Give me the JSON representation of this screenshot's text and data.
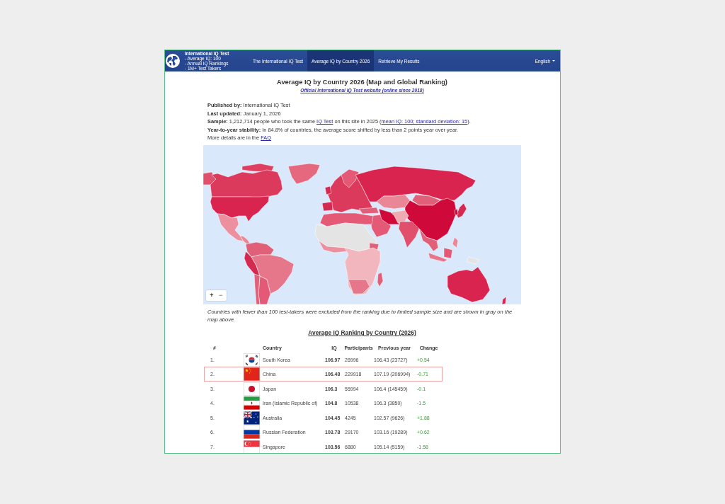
{
  "header": {
    "brand": {
      "name": "International IQ Test",
      "taglines": [
        "- Average IQ: 100",
        "- Annual IQ Rankings",
        "- 1M+ Test Takers"
      ]
    },
    "nav": [
      {
        "label": "The International IQ Test",
        "selected": false
      },
      {
        "label": "Average IQ by Country 2026",
        "selected": true
      },
      {
        "label": "Retrieve My Results",
        "selected": false
      }
    ],
    "language": "English"
  },
  "title": "Average IQ by Country 2026 (Map and Global Ranking)",
  "subtitle_link": "Official International IQ Test website (online since 2018)",
  "details": [
    {
      "segments": [
        {
          "kind": "bold",
          "text": "Published by:"
        },
        {
          "kind": "text",
          "text": " International IQ Test"
        }
      ]
    },
    {
      "segments": [
        {
          "kind": "bold",
          "text": "Last updated:"
        },
        {
          "kind": "text",
          "text": " January 1, 2026"
        }
      ]
    },
    {
      "segments": [
        {
          "kind": "bold",
          "text": "Sample:"
        },
        {
          "kind": "text",
          "text": " 1,212,714 people who took the same "
        },
        {
          "kind": "link",
          "text": "IQ Test"
        },
        {
          "kind": "text",
          "text": " on this site in 2025 ("
        },
        {
          "kind": "link",
          "text": "mean IQ: 100; standard deviation: 15"
        },
        {
          "kind": "text",
          "text": ")."
        }
      ]
    },
    {
      "segments": [
        {
          "kind": "bold",
          "text": "Year-to-year stability:"
        },
        {
          "kind": "text",
          "text": " In 84.8% of countries, the average score shifted by less than 2 points year over year."
        }
      ]
    },
    {
      "segments": [
        {
          "kind": "text",
          "text": "More details are in the "
        },
        {
          "kind": "link",
          "text": "FAQ"
        }
      ]
    }
  ],
  "map": {
    "zoom_buttons": [
      {
        "label": "+",
        "disabled": false
      },
      {
        "label": "−",
        "disabled": true
      }
    ]
  },
  "map_note": "Countries with fewer than 100 test-takers were excluded from the ranking due to limited sample size and are shown in gray on the map above.",
  "ranking": {
    "title": "Average IQ Ranking by Country (2026)",
    "columns": [
      "#",
      "Country",
      "IQ",
      "Participants",
      "Previous year",
      "Change"
    ],
    "rows": [
      {
        "rank": "1.",
        "country": "South Korea",
        "iq": "106.97",
        "participants": "26996",
        "previous_year": "106.43 (23727)",
        "change": "+0.54",
        "highlighted": false
      },
      {
        "rank": "2.",
        "country": "China",
        "iq": "106.48",
        "participants": "229918",
        "previous_year": "107.19 (206994)",
        "change": "-0.71",
        "highlighted": true
      },
      {
        "rank": "3.",
        "country": "Japan",
        "iq": "106.3",
        "participants": "55994",
        "previous_year": "106.4 (145459)",
        "change": "-0.1",
        "highlighted": false
      },
      {
        "rank": "4.",
        "country": "Iran (Islamic Republic of)",
        "iq": "104.8",
        "participants": "10538",
        "previous_year": "106.3 (3850)",
        "change": "-1.5",
        "highlighted": false
      },
      {
        "rank": "5.",
        "country": "Australia",
        "iq": "104.45",
        "participants": "4245",
        "previous_year": "102.57 (9626)",
        "change": "+1.88",
        "highlighted": false
      },
      {
        "rank": "6.",
        "country": "Russian Federation",
        "iq": "103.78",
        "participants": "29170",
        "previous_year": "103.16 (19289)",
        "change": "+0.62",
        "highlighted": false
      },
      {
        "rank": "7.",
        "country": "Singapore",
        "iq": "103.56",
        "participants": "6880",
        "previous_year": "105.14 (5159)",
        "change": "-1.58",
        "highlighted": false
      }
    ]
  }
}
